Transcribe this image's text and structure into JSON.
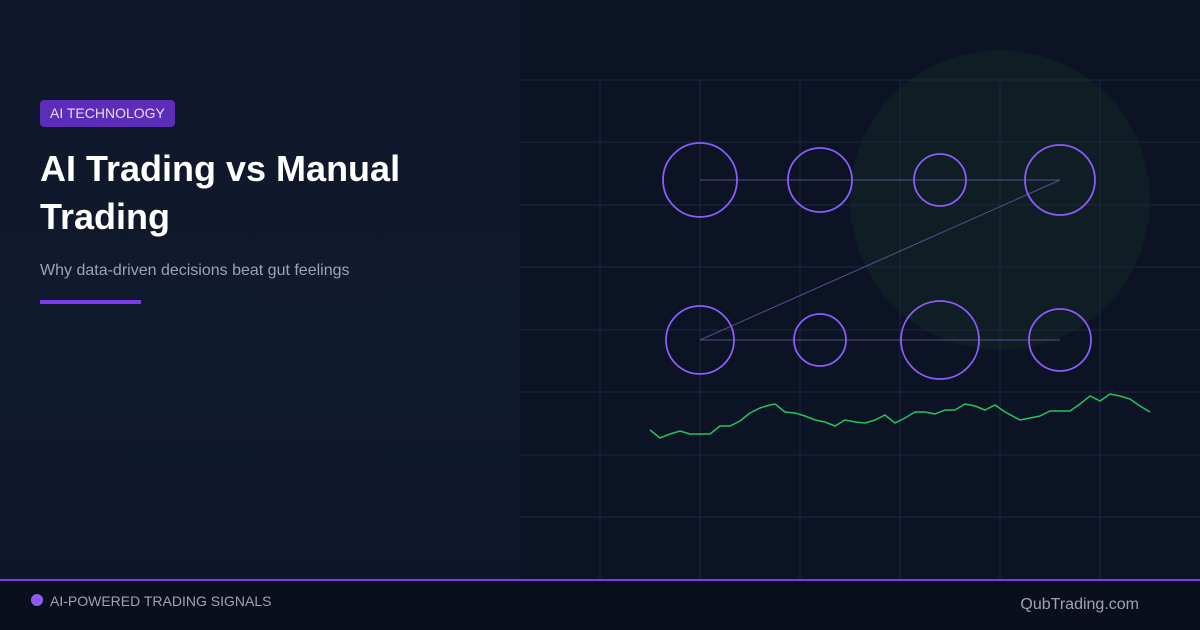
{
  "hero": {
    "badge": "AI TECHNOLOGY",
    "title": "AI Trading vs Manual Trading",
    "subtitle": "Why data-driven decisions beat gut feelings"
  },
  "footer": {
    "label": "AI-POWERED TRADING SIGNALS",
    "site": "QubTrading.com"
  },
  "visual": {
    "network_nodes_top_row": 4,
    "network_nodes_bottom_row": 4,
    "node_color": "#8b5cf6",
    "line_color": "#22c55e"
  },
  "colors": {
    "accent": "#7c3aed",
    "badge_bg": "#5b2db8",
    "background": "#0f172a",
    "glow": "#163528"
  }
}
